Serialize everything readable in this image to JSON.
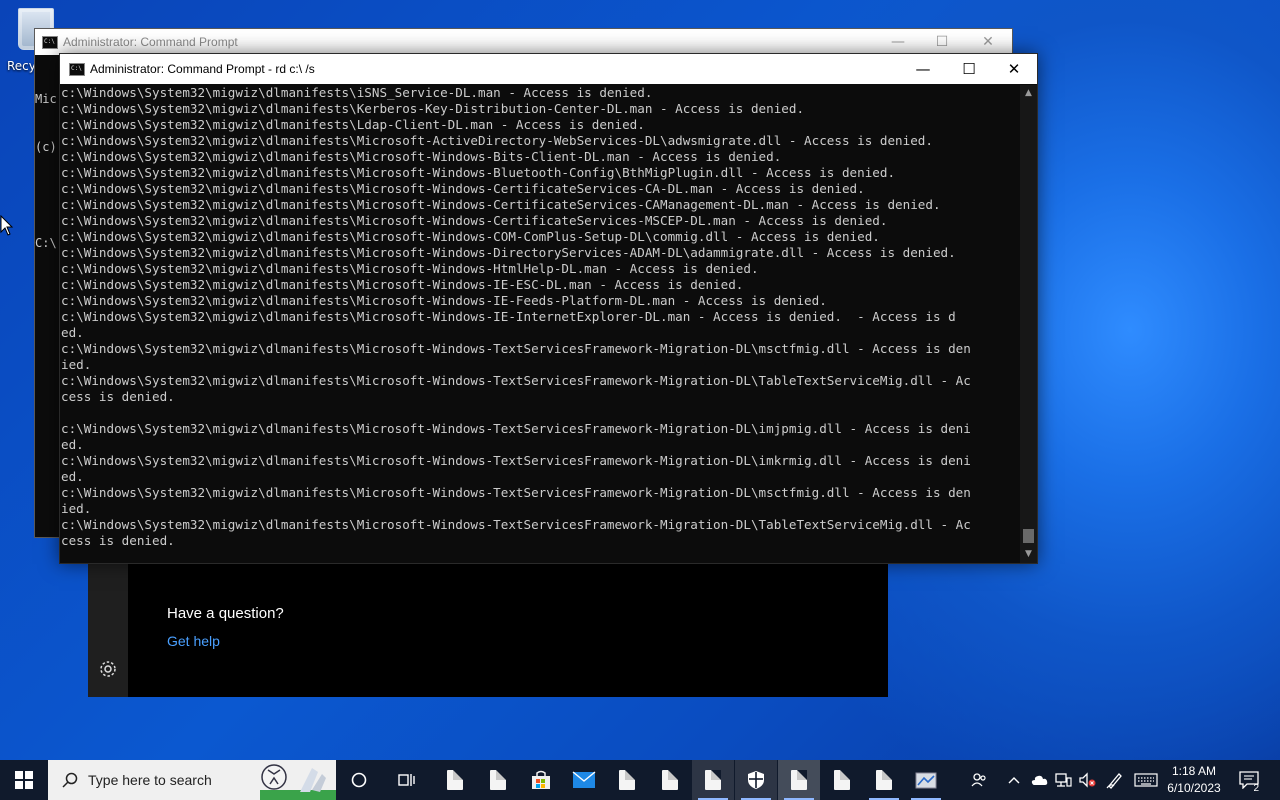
{
  "desktop": {
    "recycle_bin_label": "Recycle Bin"
  },
  "back_window": {
    "title": "Administrator:  Command Prompt",
    "lines": [
      "Mic",
      "(c)",
      "",
      "C:\\"
    ]
  },
  "front_window": {
    "title": "Administrator:  Command Prompt - rd  c:\\ /s",
    "console_lines": [
      "c:\\Windows\\System32\\migwiz\\dlmanifests\\iSNS_Service-DL.man - Access is denied.",
      "c:\\Windows\\System32\\migwiz\\dlmanifests\\Kerberos-Key-Distribution-Center-DL.man - Access is denied.",
      "c:\\Windows\\System32\\migwiz\\dlmanifests\\Ldap-Client-DL.man - Access is denied.",
      "c:\\Windows\\System32\\migwiz\\dlmanifests\\Microsoft-ActiveDirectory-WebServices-DL\\adwsmigrate.dll - Access is denied.",
      "c:\\Windows\\System32\\migwiz\\dlmanifests\\Microsoft-Windows-Bits-Client-DL.man - Access is denied.",
      "c:\\Windows\\System32\\migwiz\\dlmanifests\\Microsoft-Windows-Bluetooth-Config\\BthMigPlugin.dll - Access is denied.",
      "c:\\Windows\\System32\\migwiz\\dlmanifests\\Microsoft-Windows-CertificateServices-CA-DL.man - Access is denied.",
      "c:\\Windows\\System32\\migwiz\\dlmanifests\\Microsoft-Windows-CertificateServices-CAManagement-DL.man - Access is denied.",
      "c:\\Windows\\System32\\migwiz\\dlmanifests\\Microsoft-Windows-CertificateServices-MSCEP-DL.man - Access is denied.",
      "c:\\Windows\\System32\\migwiz\\dlmanifests\\Microsoft-Windows-COM-ComPlus-Setup-DL\\commig.dll - Access is denied.",
      "c:\\Windows\\System32\\migwiz\\dlmanifests\\Microsoft-Windows-DirectoryServices-ADAM-DL\\adammigrate.dll - Access is denied.",
      "c:\\Windows\\System32\\migwiz\\dlmanifests\\Microsoft-Windows-HtmlHelp-DL.man - Access is denied.",
      "c:\\Windows\\System32\\migwiz\\dlmanifests\\Microsoft-Windows-IE-ESC-DL.man - Access is denied.",
      "c:\\Windows\\System32\\migwiz\\dlmanifests\\Microsoft-Windows-IE-Feeds-Platform-DL.man - Access is denied.",
      "c:\\Windows\\System32\\migwiz\\dlmanifests\\Microsoft-Windows-IE-InternetExplorer-DL.man - Access is denied.  - Access is d",
      "ed.",
      "c:\\Windows\\System32\\migwiz\\dlmanifests\\Microsoft-Windows-TextServicesFramework-Migration-DL\\msctfmig.dll - Access is den",
      "ied.",
      "c:\\Windows\\System32\\migwiz\\dlmanifests\\Microsoft-Windows-TextServicesFramework-Migration-DL\\TableTextServiceMig.dll - Ac",
      "cess is denied.",
      "",
      "c:\\Windows\\System32\\migwiz\\dlmanifests\\Microsoft-Windows-TextServicesFramework-Migration-DL\\imjpmig.dll - Access is deni",
      "ed.",
      "c:\\Windows\\System32\\migwiz\\dlmanifests\\Microsoft-Windows-TextServicesFramework-Migration-DL\\imkrmig.dll - Access is deni",
      "ed.",
      "c:\\Windows\\System32\\migwiz\\dlmanifests\\Microsoft-Windows-TextServicesFramework-Migration-DL\\msctfmig.dll - Access is den",
      "ied.",
      "c:\\Windows\\System32\\migwiz\\dlmanifests\\Microsoft-Windows-TextServicesFramework-Migration-DL\\TableTextServiceMig.dll - Ac",
      "cess is denied."
    ]
  },
  "help_window": {
    "question": "Have a question?",
    "link": "Get help"
  },
  "taskbar": {
    "search_placeholder": "Type here to search",
    "time": "1:18 AM",
    "date": "6/10/2023",
    "notification_count": "2"
  },
  "colors": {
    "console_text": "#cccccc",
    "console_bg": "#0c0c0c",
    "link": "#4aa0ff",
    "taskbar_bg": "#101a2c"
  }
}
